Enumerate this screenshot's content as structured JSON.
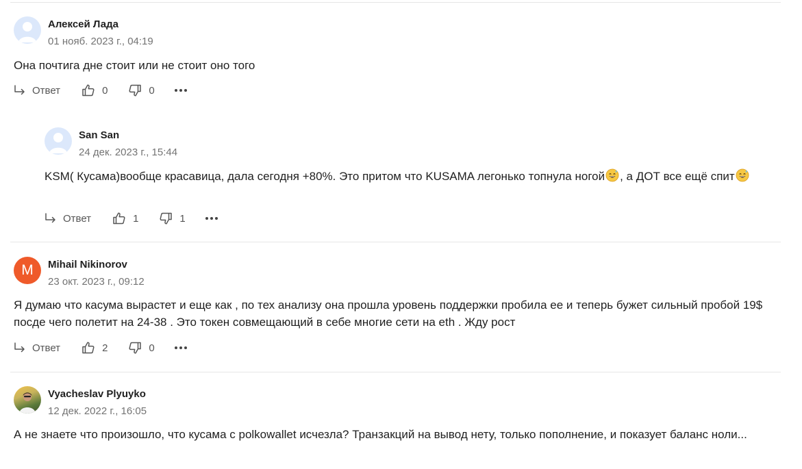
{
  "comments": [
    {
      "author": "Алексей Лада",
      "date": "01 нояб. 2023 г., 04:19",
      "text_parts": [
        "Она почтига дне стоит или не стоит оно того"
      ],
      "reply_label": "Ответ",
      "likes": "0",
      "dislikes": "0",
      "avatar": "default-avatar"
    },
    {
      "author": "San San",
      "date": "24 дек. 2023 г., 15:44",
      "text_parts": [
        "KSM( Кусама)вообще красавица, дала сегодня +80%. Это притом что KUSAMA легонько топнула ногой",
        ", а ДОТ все ещё спит",
        ""
      ],
      "emoji": "sweat-smile-emoji",
      "reply_label": "Ответ",
      "likes": "1",
      "dislikes": "1",
      "avatar": "default-avatar"
    },
    {
      "author": "Mihail Nikinorov",
      "date": "23 окт. 2023 г., 09:12",
      "avatar_letter": "M",
      "avatar_color": "#ef5a2a",
      "text_parts": [
        "Я думаю что касума вырастет и еще как , по тех анализу она прошла уровень поддержки пробила ее и теперь бужет сильный пробой 19$ посде чего полетит на 24-38 . Это токен совмещающий в себе многие сети на eth . Жду рост"
      ],
      "reply_label": "Ответ",
      "likes": "2",
      "dislikes": "0"
    },
    {
      "author": "Vyacheslav Plyuyko",
      "date": "12 дек. 2022 г., 16:05",
      "text_parts": [
        "А не знаете что произошло, что кусама с polkowallet исчезла? Транзакций на вывод нету, только пополнение, и показует баланс ноли..."
      ],
      "avatar": "photo-avatar"
    }
  ],
  "icons": {
    "reply": "reply-arrow-icon",
    "like": "thumbs-up-icon",
    "dislike": "thumbs-down-icon",
    "more": "more-dots-icon"
  },
  "colors": {
    "text": "#1f1f1f",
    "meta": "#737373",
    "separator": "#e6e6e6",
    "avatar_default": "#dce8fb",
    "avatar_letter_bg": "#ef5a2a"
  }
}
